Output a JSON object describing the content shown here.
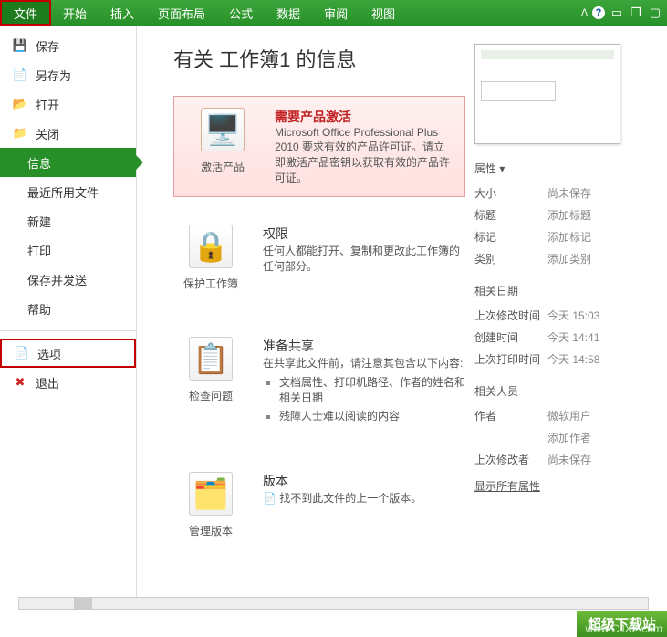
{
  "ribbon": {
    "tabs": [
      "文件",
      "开始",
      "插入",
      "页面布局",
      "公式",
      "数据",
      "审阅",
      "视图"
    ]
  },
  "sidebar": {
    "save": "保存",
    "saveAs": "另存为",
    "open": "打开",
    "close": "关闭",
    "info": "信息",
    "recent": "最近所用文件",
    "new": "新建",
    "print": "打印",
    "saveSend": "保存并发送",
    "help": "帮助",
    "options": "选项",
    "exit": "退出"
  },
  "page": {
    "title": "有关 工作簿1 的信息"
  },
  "activate": {
    "button": "激活产品",
    "title": "需要产品激活",
    "body": "Microsoft Office Professional Plus 2010 要求有效的产品许可证。请立即激活产品密钥以获取有效的产品许可证。"
  },
  "protect": {
    "button": "保护工作簿",
    "title": "权限",
    "body": "任何人都能打开、复制和更改此工作簿的任何部分。"
  },
  "inspect": {
    "button": "检查问题",
    "title": "准备共享",
    "intro": "在共享此文件前，请注意其包含以下内容:",
    "items": [
      "文档属性、打印机路径、作者的姓名和相关日期",
      "残障人士难以阅读的内容"
    ]
  },
  "versions": {
    "button": "管理版本",
    "title": "版本",
    "body": "找不到此文件的上一个版本。"
  },
  "props": {
    "head": "属性 ▾",
    "size_l": "大小",
    "size_v": "尚未保存",
    "title_l": "标题",
    "title_v": "添加标题",
    "tag_l": "标记",
    "tag_v": "添加标记",
    "cat_l": "类别",
    "cat_v": "添加类别",
    "dates_head": "相关日期",
    "mod_l": "上次修改时间",
    "mod_v": "今天 15:03",
    "create_l": "创建时间",
    "create_v": "今天 14:41",
    "print_l": "上次打印时间",
    "print_v": "今天 14:58",
    "people_head": "相关人员",
    "author_l": "作者",
    "author_v": "微软用户",
    "addauthor": "添加作者",
    "lastmod_l": "上次修改者",
    "lastmod_v": "尚未保存",
    "showall": "显示所有属性"
  },
  "watermark": {
    "badge": "超级下载站",
    "url": "www.CJXZ.com"
  }
}
